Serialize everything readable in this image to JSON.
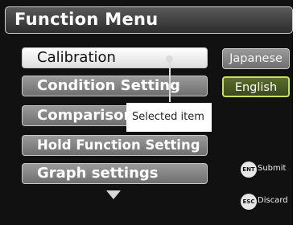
{
  "header": {
    "title": "Function Menu"
  },
  "menu": {
    "items": [
      {
        "label": "Calibration",
        "selected": true
      },
      {
        "label": "Condition Setting",
        "selected": false
      },
      {
        "label": "Comparison",
        "selected": false
      },
      {
        "label": "Hold Function Setting",
        "selected": false
      },
      {
        "label": "Graph settings",
        "selected": false
      }
    ],
    "more_indicator_icon": "triangle-down-icon"
  },
  "languages": {
    "japanese_label": "Japanese",
    "english_label": "English",
    "active": "English"
  },
  "keys": {
    "submit": {
      "icon_text": "ENT",
      "label": "Submit"
    },
    "discard": {
      "icon_text": "ESC",
      "label": "Discard"
    }
  },
  "callout": {
    "text": "Selected item"
  },
  "colors": {
    "screen_bg": "#111111",
    "active_language_border": "#c8e060",
    "active_language_bg": "#4a5a22"
  }
}
